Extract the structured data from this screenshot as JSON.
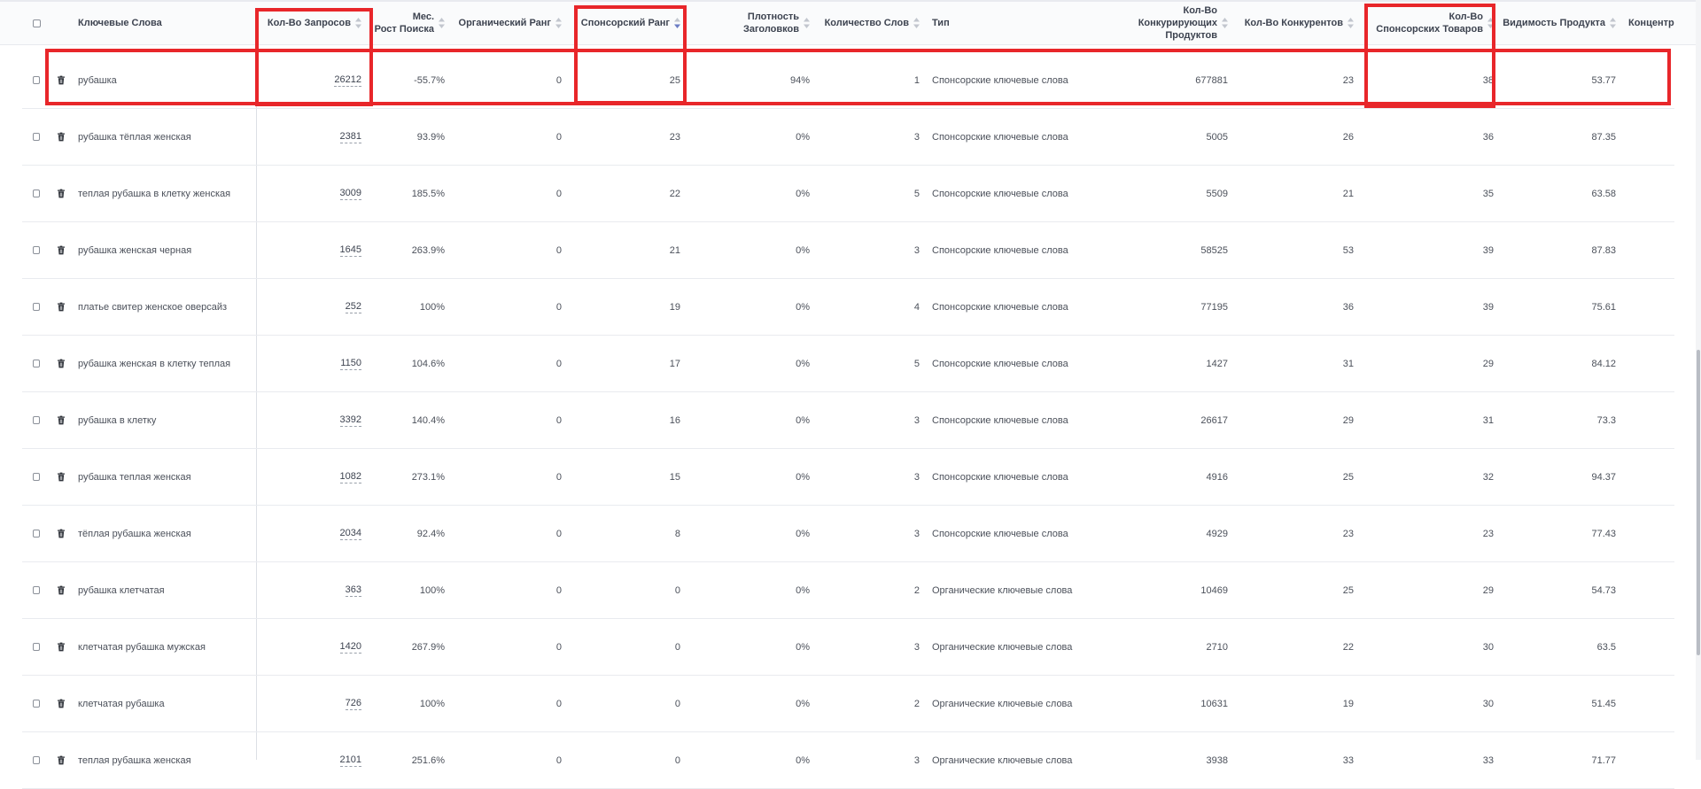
{
  "table": {
    "columns": [
      {
        "key": "keyword",
        "lines": [
          "Ключевые Слова"
        ]
      },
      {
        "key": "queries",
        "lines": [
          "Кол-Во Запросов"
        ]
      },
      {
        "key": "growth",
        "lines": [
          "Мес.",
          "Рост Поиска"
        ]
      },
      {
        "key": "organic_rank",
        "lines": [
          "Органический Ранг"
        ]
      },
      {
        "key": "sponsored_rank",
        "lines": [
          "Спонсорский Ранг"
        ]
      },
      {
        "key": "title_density",
        "lines": [
          "Плотность Заголовков"
        ]
      },
      {
        "key": "word_count",
        "lines": [
          "Количество Слов"
        ]
      },
      {
        "key": "type",
        "lines": [
          "Тип"
        ]
      },
      {
        "key": "competing_products",
        "lines": [
          "Кол-Во",
          "Конкурирующих Продуктов"
        ]
      },
      {
        "key": "competitors",
        "lines": [
          "Кол-Во Конкурентов"
        ]
      },
      {
        "key": "sponsored_items",
        "lines": [
          "Кол-Во",
          "Спонсорских Товаров"
        ]
      },
      {
        "key": "visibility",
        "lines": [
          "Видимость Продукта"
        ]
      },
      {
        "key": "concentration",
        "lines": [
          "Концентр"
        ]
      }
    ],
    "sorted_column": "sponsored_rank",
    "sort_direction": "desc",
    "rows": [
      {
        "keyword": "рубашка",
        "queries": "26212",
        "growth": "-55.7%",
        "organic_rank": "0",
        "sponsored_rank": "25",
        "title_density": "94%",
        "word_count": "1",
        "type": "Спонсорские ключевые слова",
        "competing_products": "677881",
        "competitors": "23",
        "sponsored_items": "38",
        "visibility": "53.77"
      },
      {
        "keyword": "рубашка тёплая женская",
        "queries": "2381",
        "growth": "93.9%",
        "organic_rank": "0",
        "sponsored_rank": "23",
        "title_density": "0%",
        "word_count": "3",
        "type": "Спонсорские ключевые слова",
        "competing_products": "5005",
        "competitors": "26",
        "sponsored_items": "36",
        "visibility": "87.35"
      },
      {
        "keyword": "теплая рубашка в клетку женская",
        "queries": "3009",
        "growth": "185.5%",
        "organic_rank": "0",
        "sponsored_rank": "22",
        "title_density": "0%",
        "word_count": "5",
        "type": "Спонсорские ключевые слова",
        "competing_products": "5509",
        "competitors": "21",
        "sponsored_items": "35",
        "visibility": "63.58"
      },
      {
        "keyword": "рубашка женская черная",
        "queries": "1645",
        "growth": "263.9%",
        "organic_rank": "0",
        "sponsored_rank": "21",
        "title_density": "0%",
        "word_count": "3",
        "type": "Спонсорские ключевые слова",
        "competing_products": "58525",
        "competitors": "53",
        "sponsored_items": "39",
        "visibility": "87.83"
      },
      {
        "keyword": "платье свитер женское оверсайз",
        "queries": "252",
        "growth": "100%",
        "organic_rank": "0",
        "sponsored_rank": "19",
        "title_density": "0%",
        "word_count": "4",
        "type": "Спонсорские ключевые слова",
        "competing_products": "77195",
        "competitors": "36",
        "sponsored_items": "39",
        "visibility": "75.61"
      },
      {
        "keyword": "рубашка женская в клетку теплая",
        "queries": "1150",
        "growth": "104.6%",
        "organic_rank": "0",
        "sponsored_rank": "17",
        "title_density": "0%",
        "word_count": "5",
        "type": "Спонсорские ключевые слова",
        "competing_products": "1427",
        "competitors": "31",
        "sponsored_items": "29",
        "visibility": "84.12"
      },
      {
        "keyword": "рубашка в клетку",
        "queries": "3392",
        "growth": "140.4%",
        "organic_rank": "0",
        "sponsored_rank": "16",
        "title_density": "0%",
        "word_count": "3",
        "type": "Спонсорские ключевые слова",
        "competing_products": "26617",
        "competitors": "29",
        "sponsored_items": "31",
        "visibility": "73.3"
      },
      {
        "keyword": "рубашка теплая женская",
        "queries": "1082",
        "growth": "273.1%",
        "organic_rank": "0",
        "sponsored_rank": "15",
        "title_density": "0%",
        "word_count": "3",
        "type": "Спонсорские ключевые слова",
        "competing_products": "4916",
        "competitors": "25",
        "sponsored_items": "32",
        "visibility": "94.37"
      },
      {
        "keyword": "тёплая рубашка женская",
        "queries": "2034",
        "growth": "92.4%",
        "organic_rank": "0",
        "sponsored_rank": "8",
        "title_density": "0%",
        "word_count": "3",
        "type": "Спонсорские ключевые слова",
        "competing_products": "4929",
        "competitors": "23",
        "sponsored_items": "23",
        "visibility": "77.43"
      },
      {
        "keyword": "рубашка клетчатая",
        "queries": "363",
        "growth": "100%",
        "organic_rank": "0",
        "sponsored_rank": "0",
        "title_density": "0%",
        "word_count": "2",
        "type": "Органические ключевые слова",
        "competing_products": "10469",
        "competitors": "25",
        "sponsored_items": "29",
        "visibility": "54.73"
      },
      {
        "keyword": "клетчатая рубашка мужская",
        "queries": "1420",
        "growth": "267.9%",
        "organic_rank": "0",
        "sponsored_rank": "0",
        "title_density": "0%",
        "word_count": "3",
        "type": "Органические ключевые слова",
        "competing_products": "2710",
        "competitors": "22",
        "sponsored_items": "30",
        "visibility": "63.5"
      },
      {
        "keyword": "клетчатая рубашка",
        "queries": "726",
        "growth": "100%",
        "organic_rank": "0",
        "sponsored_rank": "0",
        "title_density": "0%",
        "word_count": "2",
        "type": "Органические ключевые слова",
        "competing_products": "10631",
        "competitors": "19",
        "sponsored_items": "30",
        "visibility": "51.45"
      },
      {
        "keyword": "теплая рубашка женская",
        "queries": "2101",
        "growth": "251.6%",
        "organic_rank": "0",
        "sponsored_rank": "0",
        "title_density": "0%",
        "word_count": "3",
        "type": "Органические ключевые слова",
        "competing_products": "3938",
        "competitors": "33",
        "sponsored_items": "33",
        "visibility": "71.77"
      }
    ]
  },
  "colors": {
    "highlight": "#e8262a",
    "sort_active": "#6b7cc4",
    "sort_inactive": "#c2c6ce"
  },
  "icons": {
    "row_delete": "trash-icon",
    "sort": "sort-arrows-icon"
  }
}
